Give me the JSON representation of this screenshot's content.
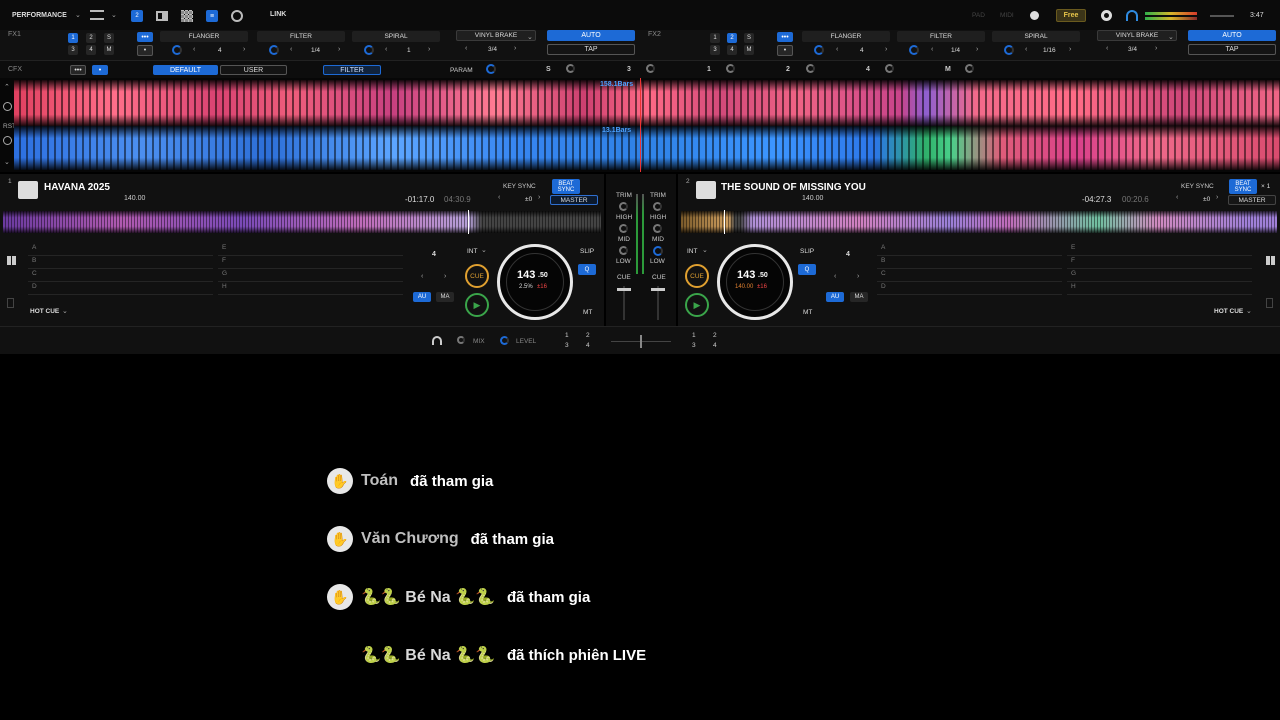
{
  "topbar": {
    "mode": "PERFORMANCE",
    "link": "LINK",
    "pad": "PAD",
    "midi": "MIDI",
    "free": "Free",
    "clock": "3:47"
  },
  "fx1": {
    "label": "FX1",
    "nums": [
      "1",
      "2",
      "S",
      "3",
      "4",
      "M"
    ],
    "effects": [
      "FLANGER",
      "FILTER",
      "SPIRAL",
      "VINYL BRAKE"
    ],
    "values": [
      "4",
      "1/4",
      "1",
      "3/4"
    ],
    "auto": "AUTO",
    "tap": "TAP"
  },
  "fx2": {
    "label": "FX2",
    "nums": [
      "1",
      "2",
      "S",
      "3",
      "4",
      "M"
    ],
    "effects": [
      "FLANGER",
      "FILTER",
      "SPIRAL",
      "VINYL BRAKE"
    ],
    "values": [
      "4",
      "1/4",
      "1/16",
      "3/4"
    ],
    "auto": "AUTO",
    "tap": "TAP"
  },
  "cfx": {
    "label": "CFX",
    "default": "DEFAULT",
    "user": "USER",
    "filter": "FILTER",
    "param": "PARAM",
    "s": "S",
    "n3": "3",
    "n1": "1",
    "n2": "2",
    "n4": "4",
    "m": "M"
  },
  "waveform": {
    "side_labels": [
      "RST"
    ],
    "bars_top": "158.1Bars",
    "bars_bottom": "13.1Bars"
  },
  "deck1": {
    "num": "1",
    "title": "HAVANA 2025",
    "bpm": "140.00",
    "remaining": "-01:17.0",
    "elapsed": "04:30.9",
    "key_sync": "KEY SYNC",
    "beat_sync": "BEAT SYNC",
    "pm": "±0",
    "master": "MASTER",
    "pads_left": [
      "A",
      "B",
      "C",
      "D"
    ],
    "pads_right": [
      "E",
      "F",
      "G",
      "H"
    ],
    "hot_cue": "HOT CUE",
    "loop": "4",
    "int": "INT",
    "slip": "SLIP",
    "q": "Q",
    "au": "AU",
    "ma": "MA",
    "cue": "CUE",
    "mt": "MT",
    "jog_bpm": "143",
    "jog_bpm_dec": ".50",
    "jog_pitch": "2.5%",
    "jog_range": "±16"
  },
  "deck2": {
    "num": "2",
    "title": "THE SOUND OF MISSING YOU",
    "bpm": "140.00",
    "remaining": "-04:27.3",
    "elapsed": "00:20.6",
    "key_sync": "KEY SYNC",
    "beat_sync": "BEAT SYNC",
    "x1": "× 1",
    "pm": "±0",
    "master": "MASTER",
    "pads_left": [
      "A",
      "B",
      "C",
      "D"
    ],
    "pads_right": [
      "E",
      "F",
      "G",
      "H"
    ],
    "hot_cue": "HOT CUE",
    "loop": "4",
    "int": "INT",
    "slip": "SLIP",
    "q": "Q",
    "au": "AU",
    "ma": "MA",
    "cue": "CUE",
    "mt": "MT",
    "jog_bpm": "143",
    "jog_bpm_dec": ".50",
    "jog_pitch": "140.00",
    "jog_range": "±16"
  },
  "mixer": {
    "trim": "TRIM",
    "high": "HIGH",
    "mid": "MID",
    "low": "LOW",
    "cue": "CUE"
  },
  "bottom": {
    "mix": "MIX",
    "level": "LEVEL",
    "left_nums": [
      "1",
      "2",
      "3",
      "4"
    ],
    "right_nums": [
      "1",
      "2",
      "3",
      "4"
    ]
  },
  "notifications": [
    {
      "name": "Toán",
      "action": "đã tham gia",
      "hand": true
    },
    {
      "name": "Văn Chương",
      "action": "đã tham gia",
      "hand": true
    },
    {
      "name": "🐍🐍 Bé Na 🐍🐍",
      "action": "đã tham gia",
      "hand": true
    },
    {
      "name": "🐍🐍 Bé Na 🐍🐍",
      "action": "đã thích phiên LIVE",
      "hand": false
    }
  ],
  "colors": {
    "accent": "#1d6ad6",
    "free": "#c9a227",
    "wave_red": "#e0405a",
    "wave_blue": "#2f7fe0"
  }
}
